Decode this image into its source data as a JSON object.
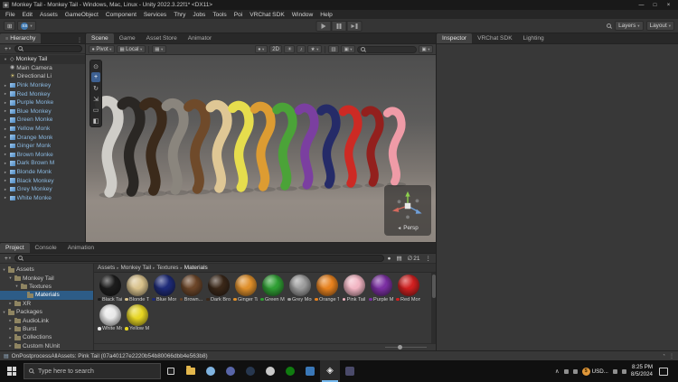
{
  "window": {
    "title": "Monkey Tail - Monkey Tail - Windows, Mac, Linux - Unity 2022.3.22f1* <DX11>",
    "menus": [
      "File",
      "Edit",
      "Assets",
      "GameObject",
      "Component",
      "Services",
      "Thry",
      "Jobs",
      "Tools",
      "Poi",
      "VRChat SDK",
      "Window",
      "Help"
    ]
  },
  "icons": {
    "minimize": "—",
    "maximize": "□",
    "close": "×",
    "caret-down": "▾",
    "arrow-right": "▸",
    "list": "≡",
    "menu": "⋮",
    "grid": "⊞",
    "grid-cells": "▦",
    "shading": "●",
    "light": "☀",
    "audio": "♪",
    "effects": "★",
    "eye": "▥",
    "frame": "▣",
    "hidden": "∅",
    "unity-scene": "◇",
    "persp-arrow": "◄",
    "status-log": "▤",
    "activity": "◔",
    "tray-up": "∧",
    "coin": "$",
    "unity-logo": "◈",
    "plus": "+"
  },
  "toolbar": {
    "account_label": "SS",
    "layers_label": "Layers",
    "layout_label": "Layout"
  },
  "hierarchy": {
    "tab_label": "Hierarchy",
    "scene_name": "Monkey Tail",
    "items": [
      {
        "label": "Main Camera",
        "icon": "camera"
      },
      {
        "label": "Directional Li",
        "icon": "light"
      },
      {
        "label": "Pink Monkey",
        "icon": "cube"
      },
      {
        "label": "Red Monkey",
        "icon": "cube"
      },
      {
        "label": "Purple Monke",
        "icon": "cube"
      },
      {
        "label": "Blue Monkey",
        "icon": "cube"
      },
      {
        "label": "Green Monke",
        "icon": "cube"
      },
      {
        "label": "Yellow Monk",
        "icon": "cube"
      },
      {
        "label": "Orange Monk",
        "icon": "cube"
      },
      {
        "label": "Ginger Monk",
        "icon": "cube"
      },
      {
        "label": "Brown Monke",
        "icon": "cube"
      },
      {
        "label": "Dark Brown M",
        "icon": "cube"
      },
      {
        "label": "Blonde Monk",
        "icon": "cube"
      },
      {
        "label": "Black Monkey",
        "icon": "cube"
      },
      {
        "label": "Grey Monkey",
        "icon": "cube"
      },
      {
        "label": "White Monke",
        "icon": "cube"
      }
    ]
  },
  "scene_view": {
    "tabs": [
      "Scene",
      "Game",
      "Asset Store",
      "Animator"
    ],
    "active_tab_index": 0,
    "pivot_label": "Pivot",
    "local_label": "Local",
    "two_d_label": "2D",
    "persp_label": "Persp",
    "tools": [
      {
        "name": "view-tool",
        "glyph": "⊙",
        "active": false
      },
      {
        "name": "move-tool",
        "glyph": "+",
        "active": true
      },
      {
        "name": "rotate-tool",
        "glyph": "↻",
        "active": false
      },
      {
        "name": "scale-tool",
        "glyph": "⇲",
        "active": false
      },
      {
        "name": "rect-tool",
        "glyph": "▭",
        "active": false
      },
      {
        "name": "transform-tool",
        "glyph": "◧",
        "active": false
      }
    ],
    "tails": [
      {
        "name": "white-tail",
        "color": "#cfcdc8"
      },
      {
        "name": "black-tail",
        "color": "#2a2724"
      },
      {
        "name": "dark-brown-tail",
        "color": "#3b2a1b"
      },
      {
        "name": "grey-tail",
        "color": "#8a857d"
      },
      {
        "name": "brown-tail",
        "color": "#6f4a2a"
      },
      {
        "name": "blonde-tail",
        "color": "#dfc795"
      },
      {
        "name": "yellow-tail",
        "color": "#e6dd4d"
      },
      {
        "name": "ginger-tail",
        "color": "#dd9c32"
      },
      {
        "name": "green-tail",
        "color": "#4ba338"
      },
      {
        "name": "purple-tail",
        "color": "#7b3fa0"
      },
      {
        "name": "blue-tail",
        "color": "#252b68"
      },
      {
        "name": "red-tail",
        "color": "#cd2a24"
      },
      {
        "name": "dark-red-tail",
        "color": "#93201d"
      },
      {
        "name": "pink-tail",
        "color": "#ef9ba7"
      }
    ]
  },
  "inspector": {
    "tabs": [
      "Inspector",
      "VRChat SDK",
      "Lighting"
    ],
    "active_tab_index": 0
  },
  "project": {
    "tabs": [
      "Project",
      "Console",
      "Animation"
    ],
    "active_tab_index": 0,
    "hidden_count": "21",
    "breadcrumb": [
      "Assets",
      "Monkey Tail",
      "Textures",
      "Materials"
    ],
    "folders": [
      {
        "label": "Assets",
        "depth": 0,
        "arrow": "▾",
        "selected": false
      },
      {
        "label": "Monkey Tail",
        "depth": 1,
        "arrow": "▾",
        "selected": false
      },
      {
        "label": "Textures",
        "depth": 2,
        "arrow": "▾",
        "selected": false
      },
      {
        "label": "Materials",
        "depth": 3,
        "arrow": "",
        "selected": true
      },
      {
        "label": "XR",
        "depth": 1,
        "arrow": "▸",
        "selected": false
      },
      {
        "label": "Packages",
        "depth": 0,
        "arrow": "▾",
        "selected": false
      },
      {
        "label": "AudioLink",
        "depth": 1,
        "arrow": "▸",
        "selected": false
      },
      {
        "label": "Burst",
        "depth": 1,
        "arrow": "▸",
        "selected": false
      },
      {
        "label": "Collections",
        "depth": 1,
        "arrow": "▸",
        "selected": false
      },
      {
        "label": "Custom NUnit",
        "depth": 1,
        "arrow": "▸",
        "selected": false
      }
    ],
    "materials": [
      {
        "label": "Black Tail",
        "color": "#1c1c1c"
      },
      {
        "label": "Blonde Tail",
        "color": "#d9c28c"
      },
      {
        "label": "Blue Monk...",
        "color": "#1d2a78"
      },
      {
        "label": "Brown...",
        "color": "#6b4528"
      },
      {
        "label": "Dark Brow...",
        "color": "#3a2718"
      },
      {
        "label": "Ginger Tail",
        "color": "#df8f2a"
      },
      {
        "label": "Green Mon...",
        "color": "#2f9e33"
      },
      {
        "label": "Grey Monk...",
        "color": "#9c9c9c"
      },
      {
        "label": "Orange Tail",
        "color": "#e8821e"
      },
      {
        "label": "Pink Tail",
        "color": "#f2b5c3"
      },
      {
        "label": "Purple Mo...",
        "color": "#7b2fa2"
      },
      {
        "label": "Red Monk...",
        "color": "#d01f1f"
      },
      {
        "label": "White Mon...",
        "color": "#e9e9e9"
      },
      {
        "label": "Yellow Mon...",
        "color": "#e7d622"
      }
    ]
  },
  "statusbar": {
    "message": "OnPostprocessAllAssets: Pink Tail (07a40127e2220b54b80066dbb4e563b8)"
  },
  "taskbar": {
    "search_placeholder": "Type here to search",
    "apps": [
      {
        "name": "file-explorer",
        "shape": "folder",
        "color": "#e3b74c",
        "active": false
      },
      {
        "name": "browser",
        "shape": "circle",
        "color": "#7fb3e0",
        "active": false
      },
      {
        "name": "discord",
        "shape": "circle",
        "color": "#5865a8",
        "active": false
      },
      {
        "name": "steam",
        "shape": "circle",
        "color": "#27374f",
        "active": false
      },
      {
        "name": "chrome",
        "shape": "circle",
        "color": "#c9c9c9",
        "active": false
      },
      {
        "name": "xbox",
        "shape": "circle",
        "color": "#107c10",
        "active": false
      },
      {
        "name": "vscode",
        "shape": "square",
        "color": "#3a78b8",
        "active": false
      },
      {
        "name": "unity",
        "shape": "glyph",
        "glyph": "◈",
        "color": "#eaeaea",
        "active": true
      },
      {
        "name": "photos",
        "shape": "square",
        "color": "#4a4a6a",
        "active": false
      }
    ],
    "widget_label": "USD...",
    "time": "8:25 PM",
    "date": "8/5/2024"
  },
  "colors": {
    "accent": "#76b9ed",
    "selection": "#2d5c87",
    "prefab_text": "#8ab8e0"
  }
}
